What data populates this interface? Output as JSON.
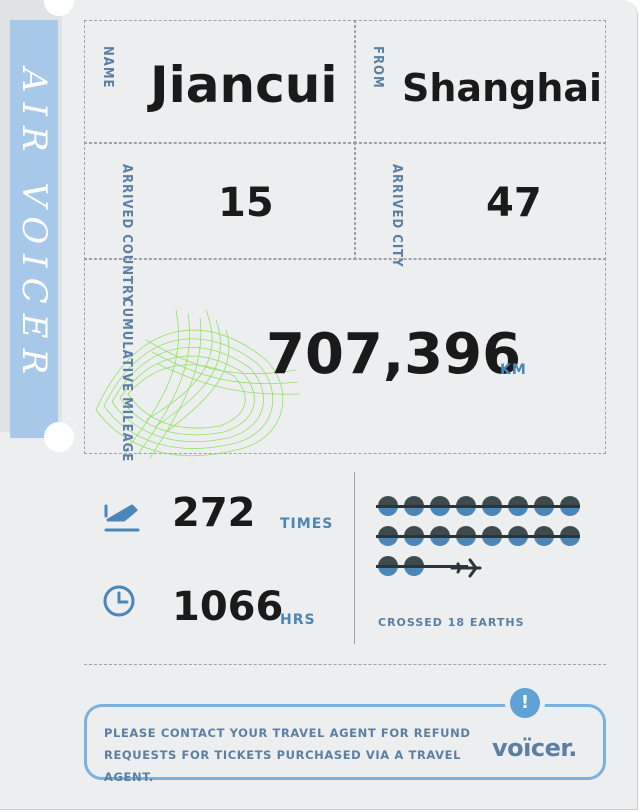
{
  "stub": {
    "brand": "AIR VOICER"
  },
  "name": {
    "label": "NAME",
    "value": "Jiancui"
  },
  "from": {
    "label": "FROM",
    "value": "Shanghai"
  },
  "arrived_country": {
    "label": "ARRIVED COUNTRY",
    "value": "15"
  },
  "arrived_city": {
    "label": "ARRIVED CITY",
    "value": "47"
  },
  "mileage": {
    "label": "CUMULATIVE MILEAGE",
    "value": "707,396",
    "unit": "KM"
  },
  "flights": {
    "icon": "airplane-takeoff-icon",
    "value": "272",
    "unit": "TIMES"
  },
  "hours": {
    "icon": "clock-icon",
    "value": "1066",
    "unit": "HRS"
  },
  "earths": {
    "count": 18,
    "caption": "CROSSED 18 EARTHS",
    "icon": "airplane-icon"
  },
  "notice": {
    "line1": "PLEASE CONTACT YOUR TRAVEL AGENT FOR REFUND",
    "line2": "REQUESTS FOR TICKETS PURCHASED VIA A TRAVEL AGENT.",
    "alert_icon": "!"
  },
  "logo": {
    "text": "voïcer."
  },
  "colors": {
    "accent": "#4a86b8",
    "stub": "#a8c8ea",
    "swirl": "#7ee24a",
    "text": "#1a1a1a"
  }
}
